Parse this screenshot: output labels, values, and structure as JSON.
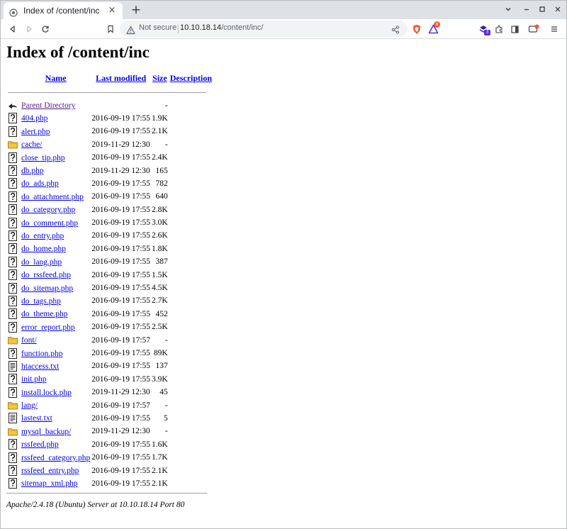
{
  "tab": {
    "title": "Index of /content/inc",
    "close": "×"
  },
  "new_tab": "+",
  "window_controls": {
    "dropdown": "⌄",
    "minimize": "–",
    "maximize": "□",
    "close": "×"
  },
  "omnibox": {
    "security_text": "Not secure",
    "url_host": "10.10.18.14",
    "url_path": "/content/inc/"
  },
  "toolbar_badges": {
    "brave_rewards": "8",
    "extensions": "3"
  },
  "page": {
    "title": "Index of /content/inc",
    "columns": {
      "name": "Name",
      "last_modified": "Last modified",
      "size": "Size",
      "description": "Description"
    },
    "parent": {
      "name": "Parent Directory",
      "size": "-"
    },
    "rows": [
      {
        "name": "404.php",
        "modified": "2016-09-19 17:55",
        "size": "1.9K",
        "type": "unknown"
      },
      {
        "name": "alert.php",
        "modified": "2016-09-19 17:55",
        "size": "2.1K",
        "type": "unknown"
      },
      {
        "name": "cache/",
        "modified": "2019-11-29 12:30",
        "size": "-",
        "type": "folder"
      },
      {
        "name": "close_tip.php",
        "modified": "2016-09-19 17:55",
        "size": "2.4K",
        "type": "unknown"
      },
      {
        "name": "db.php",
        "modified": "2019-11-29 12:30",
        "size": "165",
        "type": "unknown"
      },
      {
        "name": "do_ads.php",
        "modified": "2016-09-19 17:55",
        "size": "782",
        "type": "unknown"
      },
      {
        "name": "do_attachment.php",
        "modified": "2016-09-19 17:55",
        "size": "640",
        "type": "unknown"
      },
      {
        "name": "do_category.php",
        "modified": "2016-09-19 17:55",
        "size": "2.8K",
        "type": "unknown"
      },
      {
        "name": "do_comment.php",
        "modified": "2016-09-19 17:55",
        "size": "3.0K",
        "type": "unknown"
      },
      {
        "name": "do_entry.php",
        "modified": "2016-09-19 17:55",
        "size": "2.6K",
        "type": "unknown"
      },
      {
        "name": "do_home.php",
        "modified": "2016-09-19 17:55",
        "size": "1.8K",
        "type": "unknown"
      },
      {
        "name": "do_lang.php",
        "modified": "2016-09-19 17:55",
        "size": "387",
        "type": "unknown"
      },
      {
        "name": "do_rssfeed.php",
        "modified": "2016-09-19 17:55",
        "size": "1.5K",
        "type": "unknown"
      },
      {
        "name": "do_sitemap.php",
        "modified": "2016-09-19 17:55",
        "size": "4.5K",
        "type": "unknown"
      },
      {
        "name": "do_tags.php",
        "modified": "2016-09-19 17:55",
        "size": "2.7K",
        "type": "unknown"
      },
      {
        "name": "do_theme.php",
        "modified": "2016-09-19 17:55",
        "size": "452",
        "type": "unknown"
      },
      {
        "name": "error_report.php",
        "modified": "2016-09-19 17:55",
        "size": "2.5K",
        "type": "unknown"
      },
      {
        "name": "font/",
        "modified": "2016-09-19 17:57",
        "size": "-",
        "type": "folder"
      },
      {
        "name": "function.php",
        "modified": "2016-09-19 17:55",
        "size": "89K",
        "type": "unknown"
      },
      {
        "name": "htaccess.txt",
        "modified": "2016-09-19 17:55",
        "size": "137",
        "type": "text"
      },
      {
        "name": "init.php",
        "modified": "2016-09-19 17:55",
        "size": "3.9K",
        "type": "unknown"
      },
      {
        "name": "install.lock.php",
        "modified": "2019-11-29 12:30",
        "size": "45",
        "type": "unknown"
      },
      {
        "name": "lang/",
        "modified": "2016-09-19 17:57",
        "size": "-",
        "type": "folder"
      },
      {
        "name": "lastest.txt",
        "modified": "2016-09-19 17:55",
        "size": "5",
        "type": "text"
      },
      {
        "name": "mysql_backup/",
        "modified": "2019-11-29 12:30",
        "size": "-",
        "type": "folder"
      },
      {
        "name": "rssfeed.php",
        "modified": "2016-09-19 17:55",
        "size": "1.6K",
        "type": "unknown"
      },
      {
        "name": "rssfeed_category.php",
        "modified": "2016-09-19 17:55",
        "size": "1.7K",
        "type": "unknown"
      },
      {
        "name": "rssfeed_entry.php",
        "modified": "2016-09-19 17:55",
        "size": "2.1K",
        "type": "unknown"
      },
      {
        "name": "sitemap_xml.php",
        "modified": "2016-09-19 17:55",
        "size": "2.1K",
        "type": "unknown"
      }
    ],
    "footer": "Apache/2.4.18 (Ubuntu) Server at 10.10.18.14 Port 80"
  },
  "colors": {
    "link": "#0000ee",
    "visited": "#551a8b",
    "brave_orange": "#fb542b",
    "accent_purple": "#5b2ed6"
  },
  "icons": {
    "unknown": "unknown-file-icon",
    "folder": "folder-icon",
    "text": "text-file-icon",
    "parent": "back-arrow-icon"
  }
}
